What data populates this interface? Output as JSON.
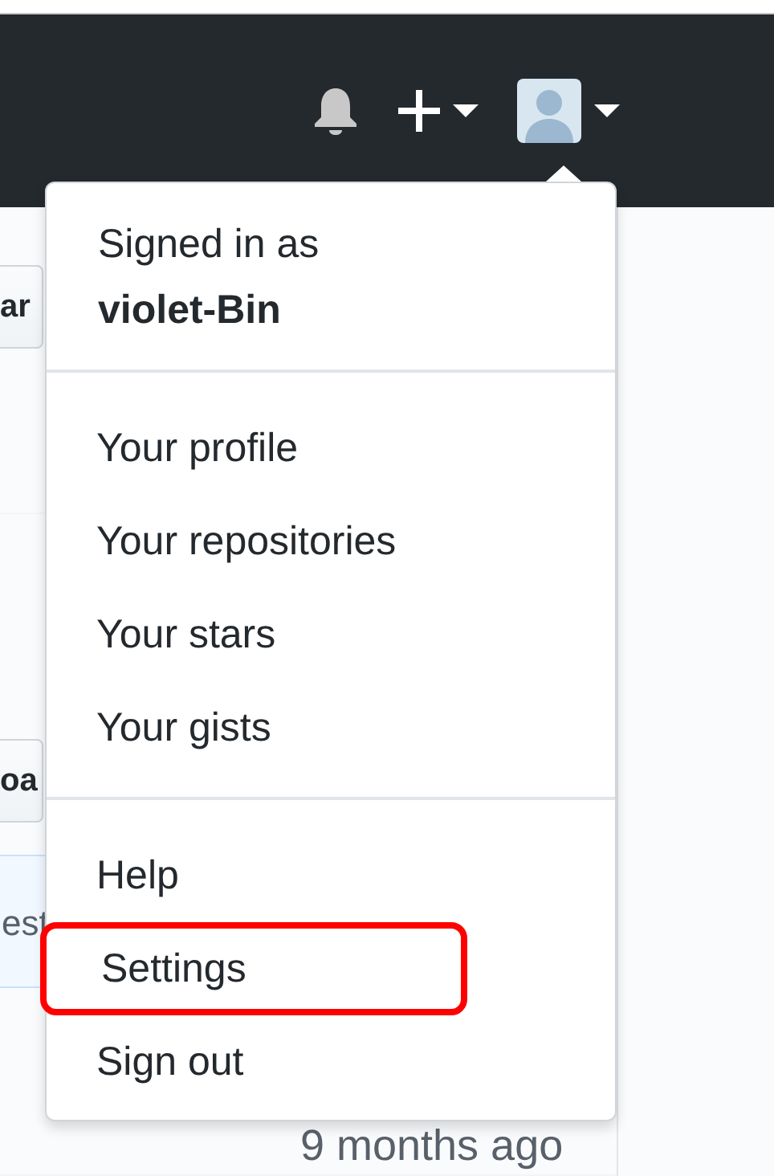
{
  "header": {
    "account_menu_expanded": true
  },
  "user_menu": {
    "signed_in_label": "Signed in as",
    "username": "violet-Bin",
    "groups": [
      [
        {
          "label": "Your profile",
          "highlighted": false
        },
        {
          "label": "Your repositories",
          "highlighted": false
        },
        {
          "label": "Your stars",
          "highlighted": false
        },
        {
          "label": "Your gists",
          "highlighted": false
        }
      ],
      [
        {
          "label": "Help",
          "highlighted": false
        },
        {
          "label": "Settings",
          "highlighted": true
        },
        {
          "label": "Sign out",
          "highlighted": false
        }
      ]
    ]
  },
  "page_fragments": [
    {
      "kind": "button",
      "text": "ar"
    },
    {
      "kind": "button",
      "text": "oa"
    },
    {
      "kind": "notice",
      "text": "est"
    }
  ],
  "timestamp": "9 months ago"
}
